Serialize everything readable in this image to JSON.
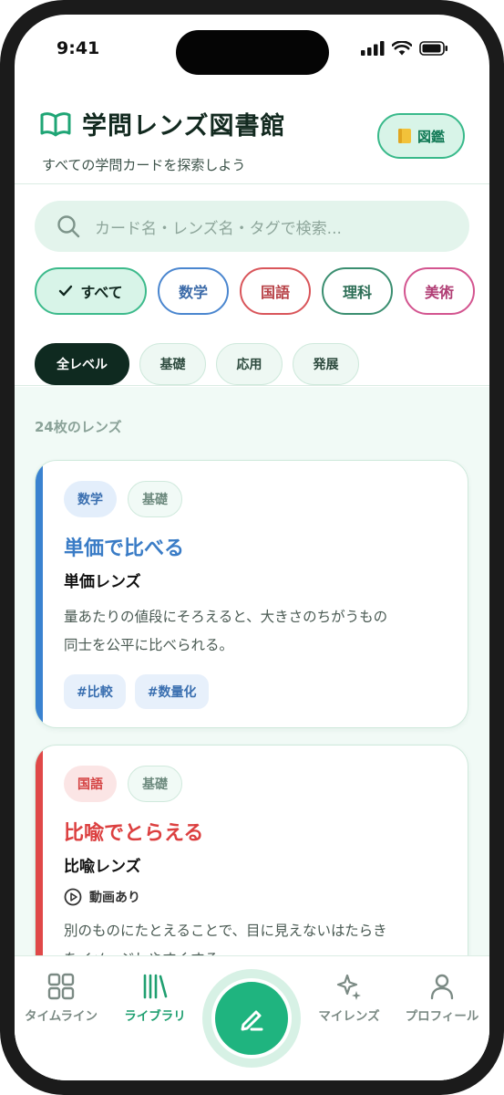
{
  "status": {
    "time": "9:41"
  },
  "header": {
    "title": "学問レンズ図書館",
    "subtitle": "すべての学問カードを探索しよう",
    "zukan_label": "図鑑"
  },
  "search": {
    "placeholder": "カード名・レンズ名・タグで検索..."
  },
  "subjects": [
    "すべて",
    "数学",
    "国語",
    "理科",
    "美術"
  ],
  "levels": [
    "全レベル",
    "基礎",
    "応用",
    "発展"
  ],
  "count_label": "24枚のレンズ",
  "cards": [
    {
      "subject": "数学",
      "level": "基礎",
      "title": "単価で比べる",
      "lens": "単価レンズ",
      "desc_lines": [
        "量あたりの値段にそろえると、大きさのちがうもの",
        "同士を公平に比べられる。"
      ],
      "tags": [
        "#比較",
        "#数量化"
      ],
      "accent": "#3a82d0"
    },
    {
      "subject": "国語",
      "level": "基礎",
      "title": "比喩でとらえる",
      "lens": "比喩レンズ",
      "video": "動画あり",
      "desc_lines": [
        "別のものにたとえることで、目に見えないはたらき",
        "をイメージしやすくする。"
      ],
      "accent": "#e04848"
    }
  ],
  "nav": {
    "timeline": "タイムライン",
    "library": "ライブラリ",
    "mylens": "マイレンズ",
    "profile": "プロフィール"
  },
  "colors": {
    "brand": "#1fb47f",
    "math": "#3a82d0",
    "japanese": "#e04848"
  }
}
